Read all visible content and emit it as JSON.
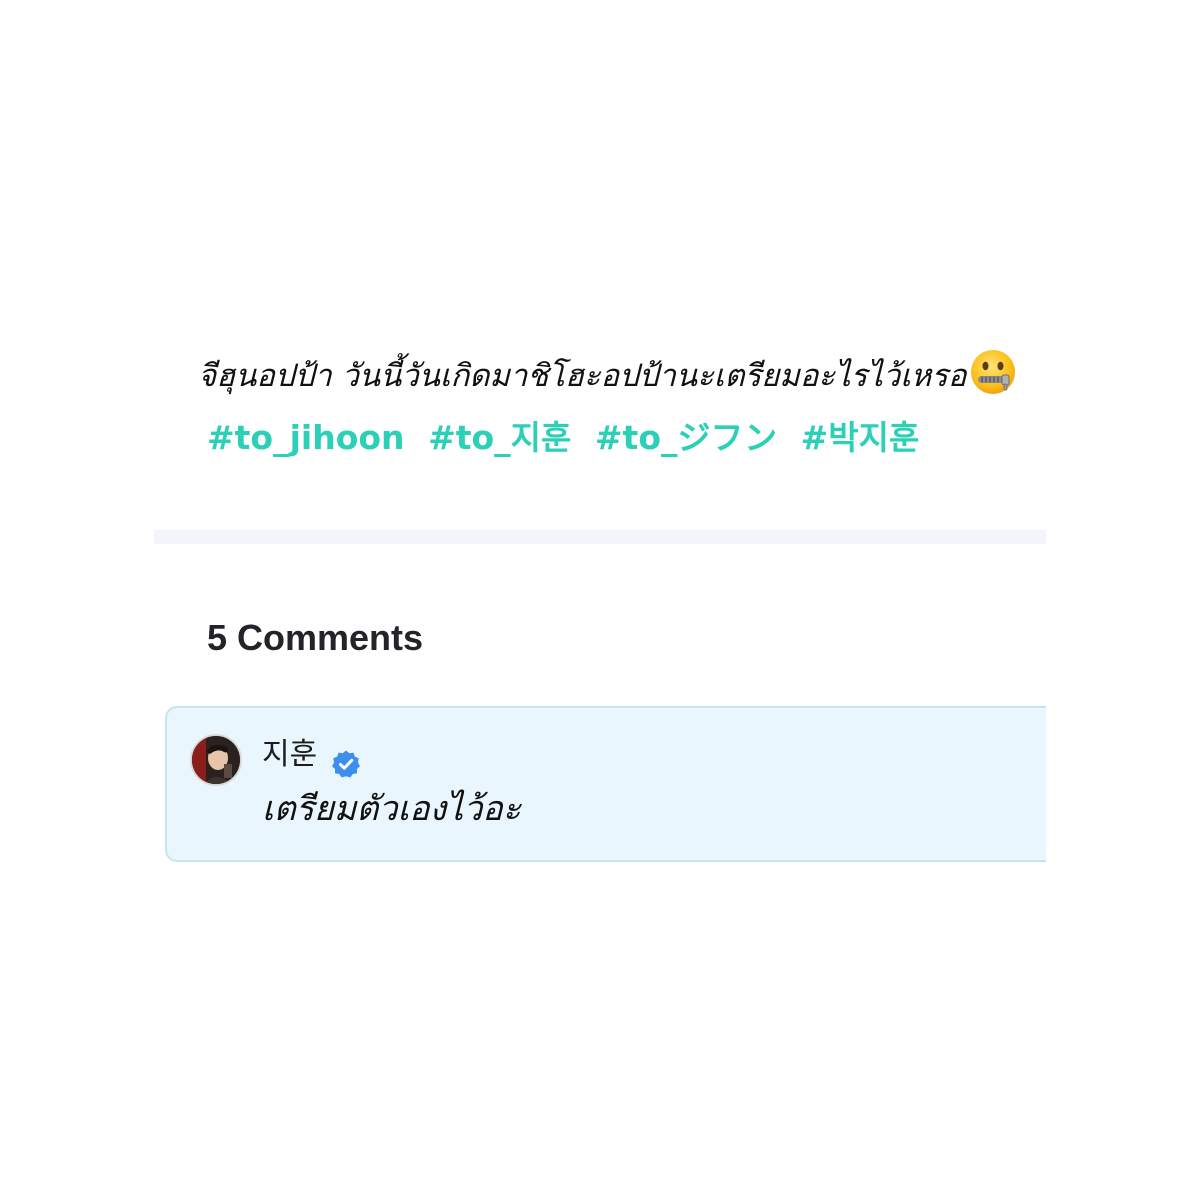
{
  "post": {
    "caption": "จีฮุนอปป้า วันนี้วันเกิดมาชิโฮะอปป้านะเตรียมอะไรไว้เหรอ",
    "caption_emoji": "zipper-mouth-face-icon",
    "hashtags": [
      "#to_jihoon",
      "#to_지훈",
      "#to_ジフン",
      "#박지훈"
    ],
    "hashtag_color": "#2bd0b7"
  },
  "comments": {
    "count_label": "5 Comments",
    "items": [
      {
        "username": "지훈",
        "verified": true,
        "verified_icon": "verified-badge-icon",
        "text": "เตรียมตัวเองไว้อะ",
        "card_color": "#eaf6fd"
      }
    ]
  }
}
